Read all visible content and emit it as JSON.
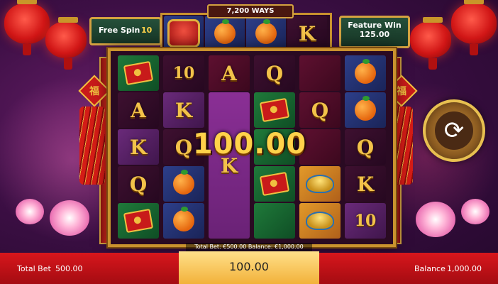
{
  "header": {
    "ways": "7,200 WAYS",
    "free_spin_label": "Free Spin",
    "free_spin_count": "10",
    "feature_win_label": "Feature Win",
    "feature_win_amount": "125.00"
  },
  "reels": {
    "col1": [
      "envelope",
      "A",
      "K",
      "Q",
      "envelope"
    ],
    "col2": [
      "10",
      "K",
      "Q",
      "orange",
      "orange"
    ],
    "col3": [
      "A",
      "",
      "K",
      "",
      ""
    ],
    "col4": [
      "Q",
      "envelope",
      "",
      "envelope",
      ""
    ],
    "col5": [
      "",
      "Q",
      "",
      "ingot",
      "ingot"
    ],
    "col6": [
      "orange",
      "orange",
      "Q",
      "K",
      "10"
    ],
    "top_row": [
      "drum",
      "orange",
      "orange",
      "K"
    ]
  },
  "win": {
    "amount": "100.00"
  },
  "spin_button": {
    "icon": "refresh-icon",
    "glyph": "⟳"
  },
  "fu_char": "福",
  "footer": {
    "total_bet_label": "Total Bet",
    "total_bet_value": "500.00",
    "center_amount": "100.00",
    "balance_label": "Balance",
    "balance_value": "1,000.00",
    "bet_info": "Total Bet: €500.00  Balance: €1,000.00"
  }
}
